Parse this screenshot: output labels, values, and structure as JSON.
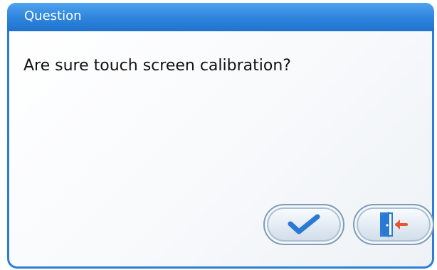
{
  "dialog": {
    "title": "Question",
    "message": "Are sure touch screen calibration?",
    "buttons": {
      "confirm": {
        "icon": "check-icon",
        "color": "#2a79d4"
      },
      "exit": {
        "icon": "exit-door-icon",
        "color": "#2a79d4",
        "arrow_color": "#e8542f"
      }
    }
  }
}
